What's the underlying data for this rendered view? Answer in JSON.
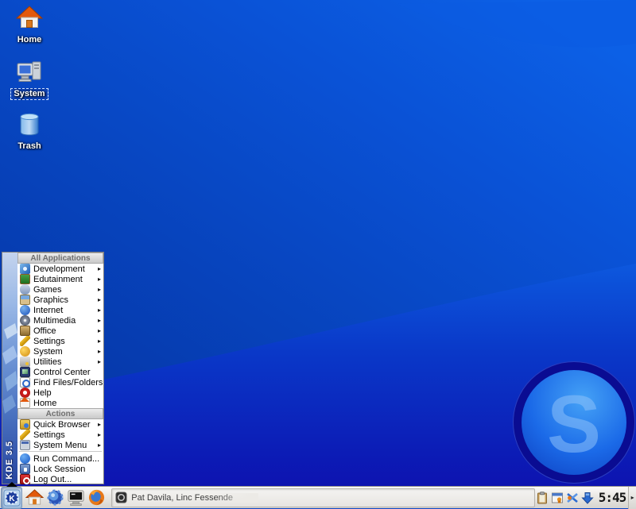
{
  "desktop": {
    "icons": [
      {
        "label": "Home",
        "icon": "home-folder-icon",
        "selected": false
      },
      {
        "label": "System",
        "icon": "computer-icon",
        "selected": true
      },
      {
        "label": "Trash",
        "icon": "trash-icon",
        "selected": false
      }
    ],
    "watermark_letter": "S"
  },
  "kmenu": {
    "branding": "KDE 3.5",
    "submenu_arrow": "▸",
    "sections": [
      {
        "header": "All Applications",
        "items": [
          {
            "label": "Development",
            "icon": "development-icon",
            "submenu": true
          },
          {
            "label": "Edutainment",
            "icon": "edutainment-icon",
            "submenu": true
          },
          {
            "label": "Games",
            "icon": "games-icon",
            "submenu": true
          },
          {
            "label": "Graphics",
            "icon": "graphics-icon",
            "submenu": true
          },
          {
            "label": "Internet",
            "icon": "internet-globe-icon",
            "submenu": true
          },
          {
            "label": "Multimedia",
            "icon": "multimedia-cd-icon",
            "submenu": true
          },
          {
            "label": "Office",
            "icon": "office-case-icon",
            "submenu": true
          },
          {
            "label": "Settings",
            "icon": "settings-wrench-icon",
            "submenu": true
          },
          {
            "label": "System",
            "icon": "system-gear-icon",
            "submenu": true
          },
          {
            "label": "Utilities",
            "icon": "utilities-tools-icon",
            "submenu": true
          },
          {
            "label": "Control Center",
            "icon": "control-center-monitor-icon",
            "submenu": false
          },
          {
            "label": "Find Files/Folders",
            "icon": "find-files-magnifier-icon",
            "submenu": false
          },
          {
            "label": "Help",
            "icon": "help-lifebuoy-icon",
            "submenu": false
          },
          {
            "label": "Home",
            "icon": "home-house-icon",
            "submenu": false
          }
        ]
      },
      {
        "header": "Actions",
        "items": [
          {
            "label": "Quick Browser",
            "icon": "quick-browser-folder-icon",
            "submenu": true
          },
          {
            "label": "Settings",
            "icon": "settings-wrench-icon",
            "submenu": true
          },
          {
            "label": "System Menu",
            "icon": "system-menu-window-icon",
            "submenu": true
          },
          {
            "label": "Run Command...",
            "icon": "run-command-icon",
            "submenu": false
          },
          {
            "label": "Lock Session",
            "icon": "lock-session-icon",
            "submenu": false
          },
          {
            "label": "Log Out...",
            "icon": "logout-power-icon",
            "submenu": false
          }
        ]
      }
    ]
  },
  "taskbar": {
    "kmenu_button": {
      "icon": "kde-gear-logo"
    },
    "quick_launch": [
      {
        "icon": "home-launcher-icon"
      },
      {
        "icon": "konqueror-globe-icon"
      },
      {
        "icon": "konsole-terminal-icon"
      },
      {
        "icon": "firefox-icon"
      }
    ],
    "task": {
      "label": "Pat Davila, Linc Fessende",
      "icon": "tllts-show-icon",
      "active": true
    },
    "tray": [
      {
        "icon": "klipper-clipboard-icon"
      },
      {
        "icon": "organizer-reminder-icon"
      },
      {
        "icon": "network-transfer-icon"
      },
      {
        "icon": "download-manager-icon"
      }
    ],
    "clock": "5:45",
    "hide_arrow": "▸"
  },
  "colors": {
    "wallpaper_top": "#0b5ce2",
    "wallpaper_dark": "#05309c",
    "wallpaper_bottom": "#0d14b2",
    "panel_bg": "#e4e2de",
    "skype_ring": "#0a0c92",
    "skype_letter": "#7fb5f8",
    "selection_blue": "#2a5fc4"
  }
}
